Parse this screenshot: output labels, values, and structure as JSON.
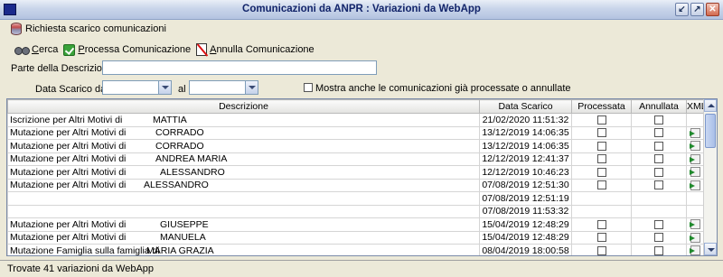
{
  "window": {
    "title": "Comunicazioni da ANPR : Variazioni da WebApp",
    "buttons": [
      "minimize",
      "maximize",
      "close"
    ]
  },
  "menu": {
    "item_label": "Richiesta scarico comunicazioni"
  },
  "toolbar": {
    "cerca": {
      "mnemonic": "C",
      "rest": "erca"
    },
    "processa": {
      "mnemonic": "P",
      "rest": "rocessa Comunicazione"
    },
    "annulla": {
      "mnemonic": "A",
      "rest": "nnulla Comunicazione"
    }
  },
  "filters": {
    "descrizione_label": "Parte della Descrizione",
    "descrizione_value": "",
    "data_dal_label": "Data Scarico dal",
    "data_dal_value": "",
    "data_al_label": "al",
    "data_al_value": "",
    "mostra_label": "Mostra anche le comunicazioni già processate o annullate"
  },
  "table": {
    "columns": [
      "Descrizione",
      "Data Scarico",
      "Processata",
      "Annullata",
      "XML"
    ],
    "rows": [
      {
        "descrizione": "Iscrizione per Altri Motivi di",
        "nome": "MATTIA",
        "data": "21/02/2020 11:51:32",
        "xml": false
      },
      {
        "descrizione": "Mutazione per Altri Motivi di",
        "nome": "CORRADO",
        "data": "13/12/2019 14:06:35",
        "xml": true
      },
      {
        "descrizione": "Mutazione per Altri Motivi di",
        "nome": "CORRADO",
        "data": "13/12/2019 14:06:35",
        "xml": true
      },
      {
        "descrizione": "Mutazione per Altri Motivi di",
        "nome": "ANDREA MARIA",
        "data": "12/12/2019 12:41:37",
        "xml": true
      },
      {
        "descrizione": "Mutazione per Altri Motivi di",
        "nome": "ALESSANDRO",
        "data": "12/12/2019 10:46:23",
        "xml": true
      },
      {
        "descrizione": "Mutazione per Altri Motivi di",
        "nome": "ALESSANDRO",
        "data": "07/08/2019 12:51:30",
        "xml": true
      },
      {
        "descrizione": "",
        "nome": "",
        "data": "07/08/2019 12:51:19",
        "xml": false
      },
      {
        "descrizione": "",
        "nome": "",
        "data": "07/08/2019 11:53:32",
        "xml": false
      },
      {
        "descrizione": "Mutazione per Altri Motivi di",
        "nome": "GIUSEPPE",
        "data": "15/04/2019 12:48:29",
        "xml": true
      },
      {
        "descrizione": "Mutazione per Altri Motivi di",
        "nome": "MANUELA",
        "data": "15/04/2019 12:48:29",
        "xml": true
      },
      {
        "descrizione": "Mutazione Famiglia sulla famiglia di",
        "nome": "MARIA GRAZIA",
        "data": "08/04/2019 18:00:58",
        "xml": true
      }
    ]
  },
  "status": {
    "text": "Trovate 41 variazioni da WebApp"
  }
}
